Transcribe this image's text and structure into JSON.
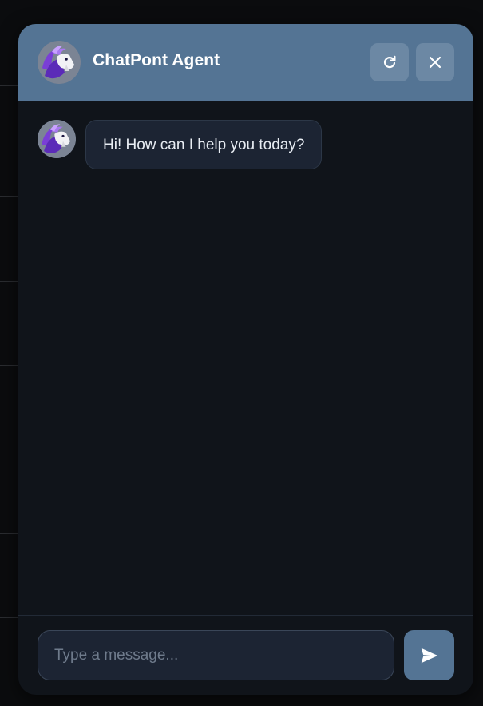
{
  "agent": {
    "name": "ChatPont Agent",
    "avatar_icon": "goat-avatar-icon"
  },
  "header": {
    "buttons": [
      {
        "name": "refresh-button",
        "icon": "refresh-icon"
      },
      {
        "name": "close-button",
        "icon": "close-icon"
      }
    ]
  },
  "messages": [
    {
      "sender": "agent",
      "text": "Hi! How can I help you today?"
    }
  ],
  "composer": {
    "placeholder": "Type a message...",
    "value": "",
    "send_icon": "send-icon"
  },
  "colors": {
    "header_bg": "#547494",
    "panel_bg": "#10141a",
    "bubble_bg": "#1c2433",
    "accent": "#547494"
  }
}
